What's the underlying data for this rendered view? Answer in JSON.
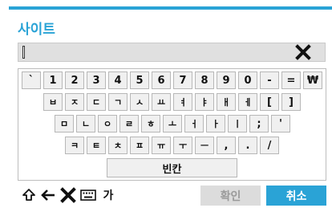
{
  "dialog": {
    "title": "사이트",
    "input_value": ""
  },
  "keyboard": {
    "row1": [
      "`",
      "1",
      "2",
      "3",
      "4",
      "5",
      "6",
      "7",
      "8",
      "9",
      "0",
      "-",
      "=",
      "₩"
    ],
    "row2": [
      "ㅂ",
      "ㅈ",
      "ㄷ",
      "ㄱ",
      "ㅅ",
      "ㅛ",
      "ㅕ",
      "ㅑ",
      "ㅐ",
      "ㅔ",
      "[",
      "]"
    ],
    "row3": [
      "ㅁ",
      "ㄴ",
      "ㅇ",
      "ㄹ",
      "ㅎ",
      "ㅗ",
      "ㅓ",
      "ㅏ",
      "ㅣ",
      ";",
      "'"
    ],
    "row4": [
      "ㅋ",
      "ㅌ",
      "ㅊ",
      "ㅍ",
      "ㅠ",
      "ㅜ",
      "ㅡ",
      ",",
      ".",
      "/"
    ],
    "space_label": "빈칸",
    "hangul_toggle_label": "가"
  },
  "actions": {
    "confirm_label": "확인",
    "cancel_label": "취소"
  },
  "colors": {
    "accent": "#2aa3d6",
    "disabled": "#dcdcdc"
  },
  "icons": {
    "clear": "close-icon",
    "shift": "shift-icon",
    "backspace": "backspace-arrow-icon",
    "delete": "close-icon",
    "keyboard": "keyboard-icon"
  }
}
